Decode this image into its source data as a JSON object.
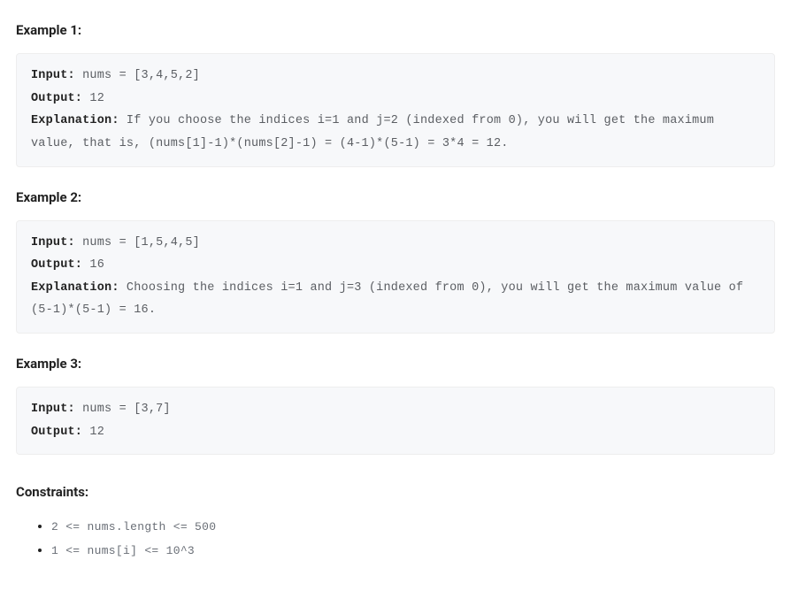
{
  "examples": [
    {
      "heading": "Example 1:",
      "input_label": "Input:",
      "input_value": " nums = [3,4,5,2]",
      "output_label": "Output:",
      "output_value": " 12",
      "has_explanation": true,
      "explanation_label": "Explanation:",
      "explanation_value": " If you choose the indices i=1 and j=2 (indexed from 0), you will get the maximum value, that is, (nums[1]-1)*(nums[2]-1) = (4-1)*(5-1) = 3*4 = 12."
    },
    {
      "heading": "Example 2:",
      "input_label": "Input:",
      "input_value": " nums = [1,5,4,5]",
      "output_label": "Output:",
      "output_value": " 16",
      "has_explanation": true,
      "explanation_label": "Explanation:",
      "explanation_value": " Choosing the indices i=1 and j=3 (indexed from 0), you will get the maximum value of (5-1)*(5-1) = 16."
    },
    {
      "heading": "Example 3:",
      "input_label": "Input:",
      "input_value": " nums = [3,7]",
      "output_label": "Output:",
      "output_value": " 12",
      "has_explanation": false,
      "explanation_label": "",
      "explanation_value": ""
    }
  ],
  "constraints": {
    "heading": "Constraints:",
    "items": [
      "2 <= nums.length <= 500",
      "1 <= nums[i] <= 10^3"
    ]
  }
}
